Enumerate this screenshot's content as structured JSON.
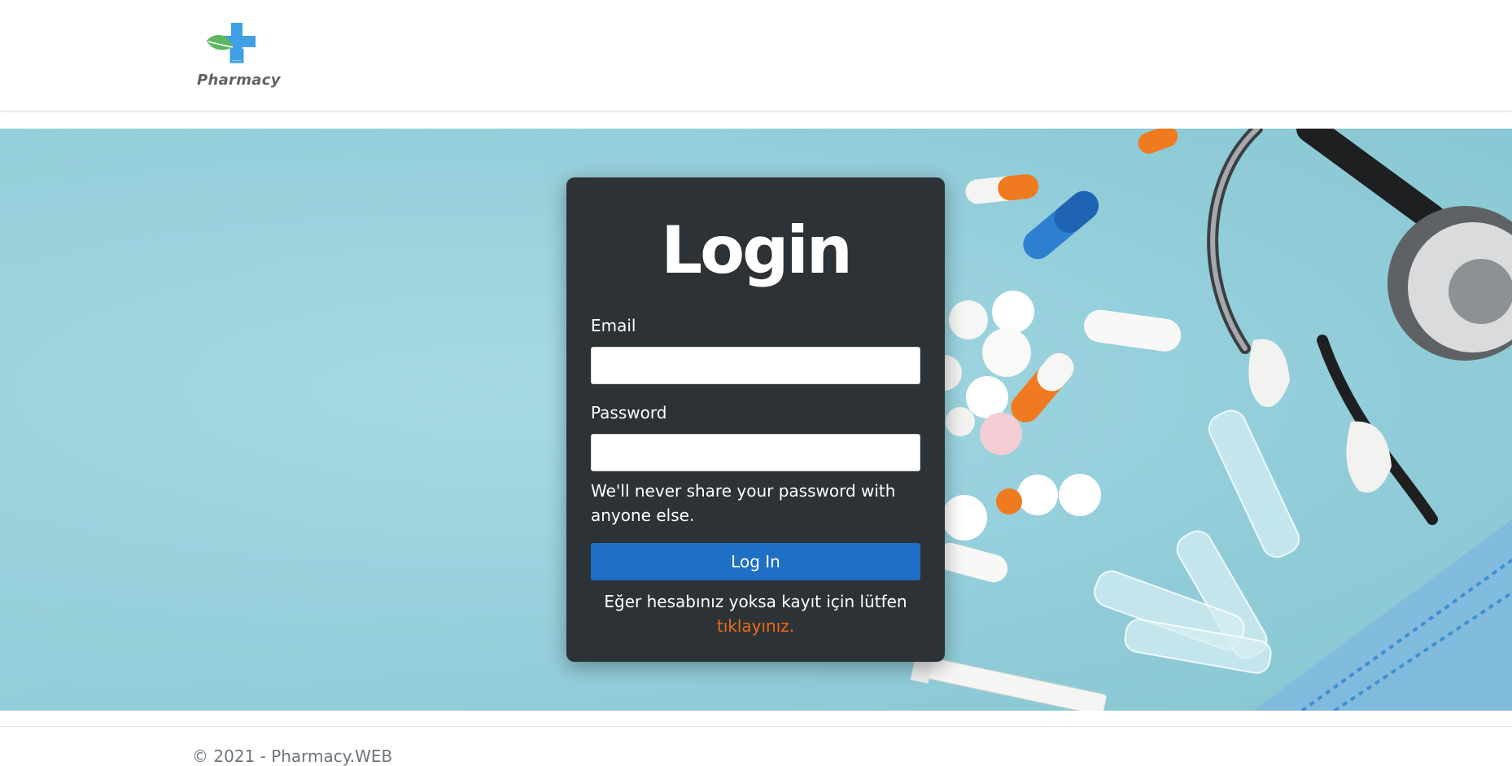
{
  "brand": {
    "name": "Pharmacy",
    "colors": {
      "cross": "#3fa0e3",
      "leaf": "#5cb85c",
      "text": "#5f6368"
    }
  },
  "login": {
    "title": "Login",
    "email_label": "Email",
    "email_value": "",
    "password_label": "Password",
    "password_value": "",
    "help_text": "We'll never share your password with anyone else.",
    "button_label": "Log In",
    "register_text": "Eğer hesabınız yoksa kayıt için lütfen",
    "register_link": "tıklayınız.",
    "colors": {
      "card": "#2c3235",
      "button": "#1f6fc5",
      "link": "#f26a1b"
    }
  },
  "hero": {
    "background_color": "#9ad2dd",
    "illustration": "pills-stethoscope-syringe"
  },
  "footer": {
    "text": "© 2021 - Pharmacy.WEB"
  }
}
